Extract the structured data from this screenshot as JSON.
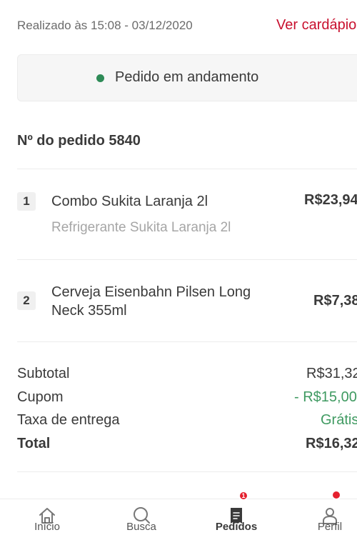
{
  "header": {
    "placed_text": "Realizado às 15:08 - 03/12/2020",
    "menu_link": "Ver cardápio"
  },
  "status": {
    "text": "Pedido em andamento",
    "dot_color": "#2e8b57"
  },
  "order": {
    "number_label": "Nº do pedido 5840"
  },
  "items": [
    {
      "qty": "1",
      "name": "Combo Sukita Laranja 2l",
      "description": "Refrigerante Sukita Laranja 2l",
      "price": "R$23,94"
    },
    {
      "qty": "2",
      "name": "Cerveja Eisenbahn Pilsen Long Neck 355ml",
      "price": "R$7,38"
    }
  ],
  "summary": {
    "subtotal_label": "Subtotal",
    "subtotal_value": "R$31,32",
    "coupon_label": "Cupom",
    "coupon_value": "- R$15,00",
    "delivery_label": "Taxa de entrega",
    "delivery_value": "Grátis",
    "total_label": "Total",
    "total_value": "R$16,32"
  },
  "nav": {
    "home": "Início",
    "search": "Busca",
    "orders": "Pedidos",
    "orders_badge": "1",
    "profile": "Perfil"
  },
  "colors": {
    "accent": "#c8102e",
    "positive": "#3f9a61",
    "badge": "#e5202e"
  }
}
